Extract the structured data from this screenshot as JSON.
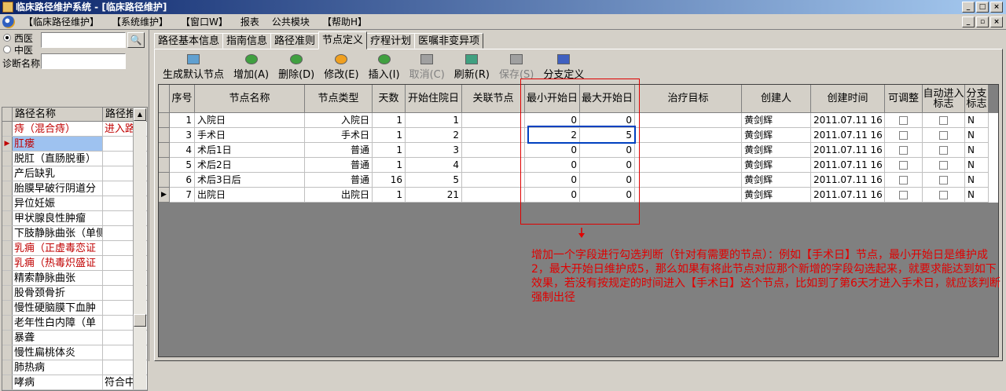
{
  "window": {
    "title": "临床路径维护系统 - [临床路径维护]"
  },
  "menu": [
    "【临床路径维护】",
    "【系统维护】",
    "【窗口W】",
    "报表",
    "公共模块",
    "【帮助H】"
  ],
  "left": {
    "radio_west": "西医",
    "radio_chinese": "中医",
    "diag_label": "诊断名称",
    "col_name": "路径名称",
    "col_flag": "路径推",
    "rows": [
      {
        "name": "痔（混合痔）",
        "flag": "进入路",
        "red": true
      },
      {
        "name": "肛瘘",
        "flag": "",
        "red": true,
        "selected": true
      },
      {
        "name": "脱肛（直肠脱垂）",
        "flag": ""
      },
      {
        "name": "产后缺乳",
        "flag": ""
      },
      {
        "name": "胎膜早破行阴道分",
        "flag": ""
      },
      {
        "name": "异位妊娠",
        "flag": ""
      },
      {
        "name": "甲状腺良性肿瘤",
        "flag": ""
      },
      {
        "name": "下肢静脉曲张（单侧",
        "flag": ""
      },
      {
        "name": "乳痈（正虚毒恋证",
        "flag": "",
        "red": true
      },
      {
        "name": "乳痈（热毒炽盛证",
        "flag": "",
        "red": true
      },
      {
        "name": "精索静脉曲张",
        "flag": ""
      },
      {
        "name": "股骨颈骨折",
        "flag": ""
      },
      {
        "name": "慢性硬脑膜下血肿",
        "flag": ""
      },
      {
        "name": "老年性白内障（单",
        "flag": ""
      },
      {
        "name": "暴聋",
        "flag": ""
      },
      {
        "name": "慢性扁桃体炎",
        "flag": ""
      },
      {
        "name": "肺热病",
        "flag": ""
      },
      {
        "name": "哮病",
        "flag": "符合中"
      }
    ]
  },
  "tabs": [
    "路径基本信息",
    "指南信息",
    "路径准则",
    "节点定义",
    "疗程计划",
    "医嘱非变异项"
  ],
  "toolbar": [
    {
      "label": "生成默认节点",
      "color": "#60a0d0",
      "disabled": false
    },
    {
      "label": "增加(A)",
      "color": "#40a040",
      "disabled": false
    },
    {
      "label": "删除(D)",
      "color": "#40a040",
      "disabled": false
    },
    {
      "label": "修改(E)",
      "color": "#f0a020",
      "disabled": false
    },
    {
      "label": "插入(I)",
      "color": "#40a040",
      "disabled": false
    },
    {
      "label": "取消(C)",
      "color": "#a0a0a0",
      "disabled": true
    },
    {
      "label": "刷新(R)",
      "color": "#40a080",
      "disabled": false
    },
    {
      "label": "保存(S)",
      "color": "#a0a0a0",
      "disabled": true
    },
    {
      "label": "分支定义",
      "color": "#4060c0",
      "disabled": false
    }
  ],
  "grid": {
    "headers": [
      "序号",
      "节点名称",
      "节点类型",
      "天数",
      "开始住院日",
      "关联节点",
      "最小开始日",
      "最大开始日",
      "治疗目标",
      "创建人",
      "创建时间",
      "可调整",
      "自动进入标志",
      "分支标志"
    ],
    "rows": [
      {
        "seq": "1",
        "name": "入院日",
        "type": "入院日",
        "days": "1",
        "start": "1",
        "min": "0",
        "max": "0",
        "creator": "黄剑辉",
        "time": "2011.07.11 16",
        "branch": "N"
      },
      {
        "seq": "3",
        "name": "手术日",
        "type": "手术日",
        "days": "1",
        "start": "2",
        "min": "2",
        "max": "5",
        "creator": "黄剑辉",
        "time": "2011.07.11 16",
        "branch": "N"
      },
      {
        "seq": "4",
        "name": "术后1日",
        "type": "普通",
        "days": "1",
        "start": "3",
        "min": "0",
        "max": "0",
        "creator": "黄剑辉",
        "time": "2011.07.11 16",
        "branch": "N"
      },
      {
        "seq": "5",
        "name": "术后2日",
        "type": "普通",
        "days": "1",
        "start": "4",
        "min": "0",
        "max": "0",
        "creator": "黄剑辉",
        "time": "2011.07.11 16",
        "branch": "N"
      },
      {
        "seq": "6",
        "name": "术后3日后",
        "type": "普通",
        "days": "16",
        "start": "5",
        "min": "0",
        "max": "0",
        "creator": "黄剑辉",
        "time": "2011.07.11 16",
        "branch": "N"
      },
      {
        "seq": "7",
        "name": "出院日",
        "type": "出院日",
        "days": "1",
        "start": "21",
        "min": "0",
        "max": "0",
        "creator": "黄剑辉",
        "time": "2011.07.11 16",
        "branch": "N"
      }
    ]
  },
  "annotation": "增加一个字段进行勾选判断（针对有需要的节点）：例如【手术日】节点，最小开始日是维护成2，最大开始日维护成5，那么如果有将此节点对应那个新增的字段勾选起来，就要求能达到如下效果，若没有按规定的时间进入【手术日】这个节点，比如到了第6天才进入手术日，就应该判断强制出径"
}
